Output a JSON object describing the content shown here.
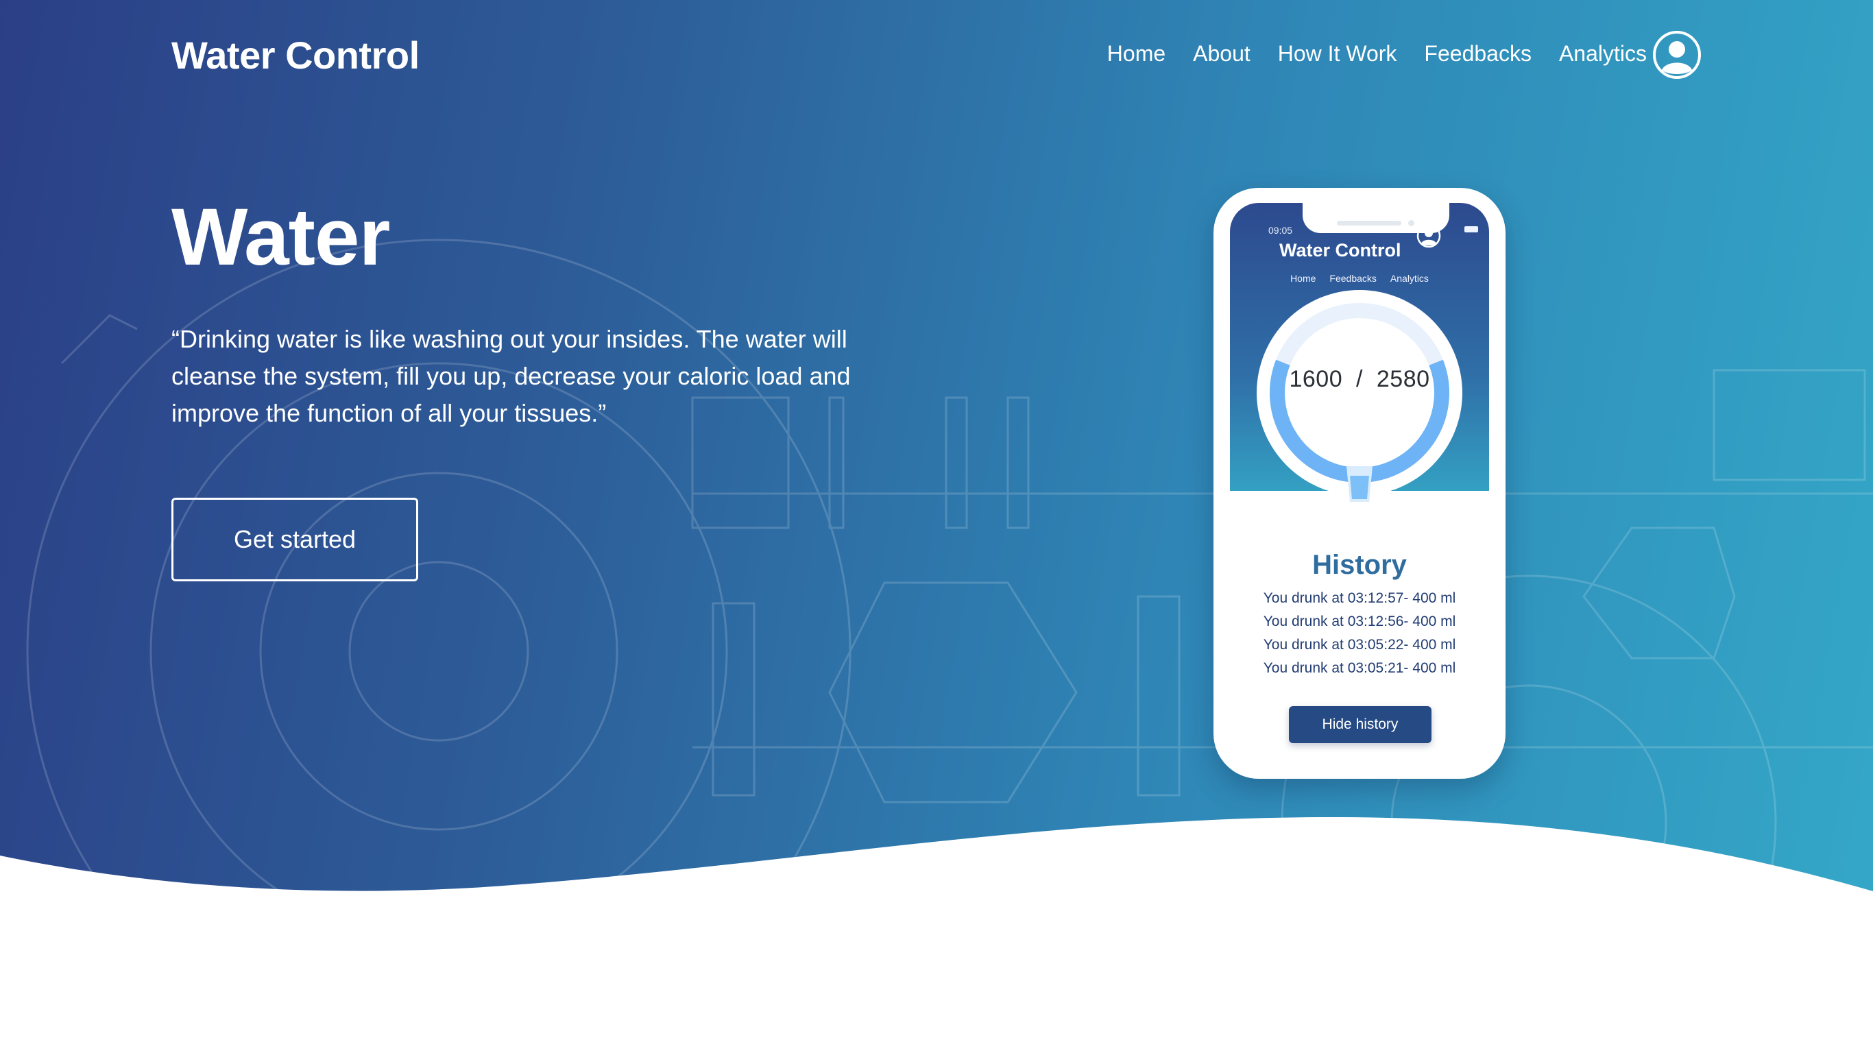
{
  "colors": {
    "gradient_start": "#2b3f86",
    "gradient_end": "#34a8c8",
    "gauge_ring": "#6db3f5",
    "history_title": "#2f6d9f",
    "history_text": "#213c73",
    "hide_button": "#264b84"
  },
  "header": {
    "brand": "Water Control",
    "nav": [
      "Home",
      "About",
      "How It Work",
      "Feedbacks",
      "Analytics"
    ],
    "user_icon": "user-circle-icon"
  },
  "hero": {
    "title": "Water",
    "quote": "“Drinking water is like washing out your insides. The water will cleanse the system, fill you up, decrease your caloric load and improve the function of all your tissues.”",
    "cta_label": "Get started"
  },
  "phone": {
    "status_time": "09:05",
    "brand": "Water Control",
    "nav": [
      "Home",
      "Feedbacks",
      "Analytics"
    ],
    "gauge": {
      "current": "1600",
      "separator": "/",
      "goal": "2580",
      "progress_fraction": 0.62
    },
    "cup_icon": "water-glass-icon",
    "history": {
      "title": "History",
      "entries": [
        "You drunk at 03:12:57- 400 ml",
        "You drunk at 03:12:56- 400 ml",
        "You drunk at 03:05:22- 400 ml",
        "You drunk at 03:05:21- 400 ml"
      ],
      "hide_label": "Hide history"
    }
  }
}
